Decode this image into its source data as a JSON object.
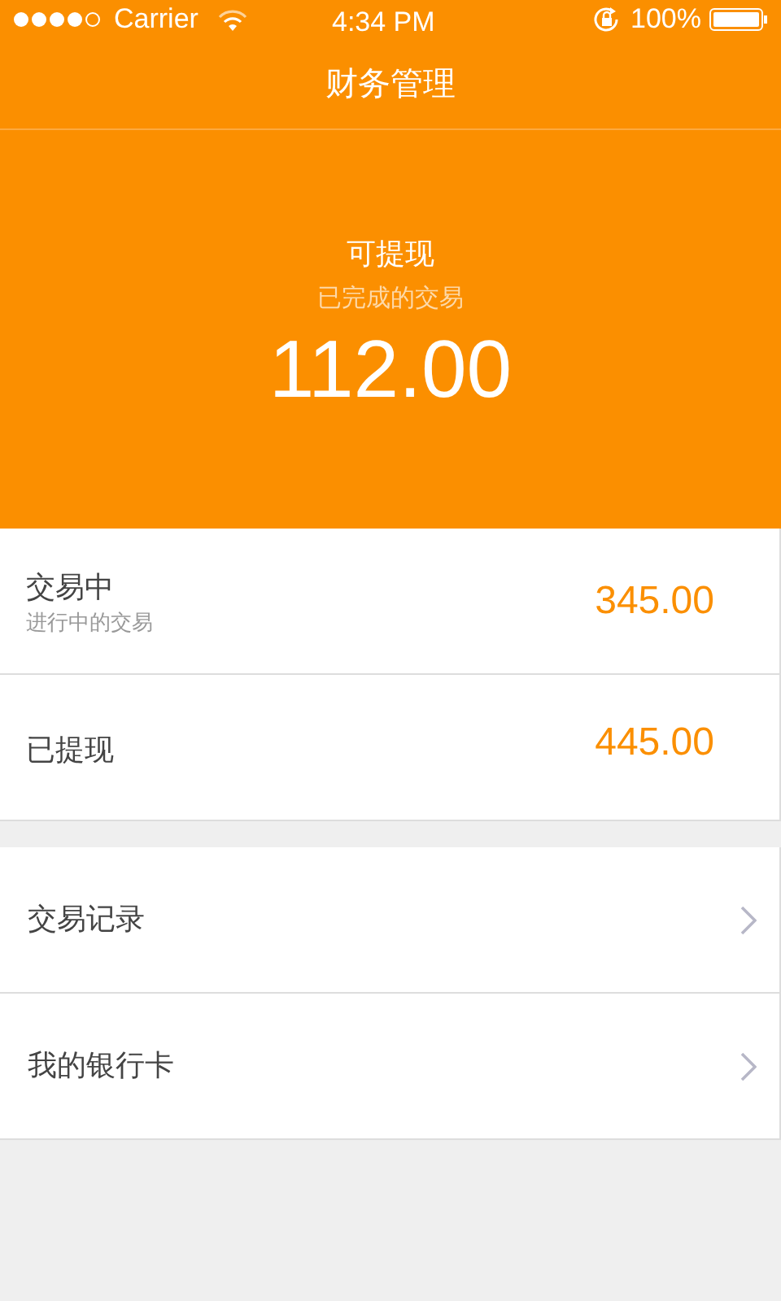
{
  "status_bar": {
    "carrier": "Carrier",
    "time": "4:34 PM",
    "battery": "100%"
  },
  "nav": {
    "title": "财务管理"
  },
  "balance": {
    "label": "可提现",
    "sublabel": "已完成的交易",
    "amount": "112.00"
  },
  "summary": [
    {
      "title": "交易中",
      "subtitle": "进行中的交易",
      "amount": "345.00"
    },
    {
      "title": "已提现",
      "amount": "445.00"
    }
  ],
  "menu": [
    {
      "label": "交易记录"
    },
    {
      "label": "我的银行卡"
    }
  ]
}
